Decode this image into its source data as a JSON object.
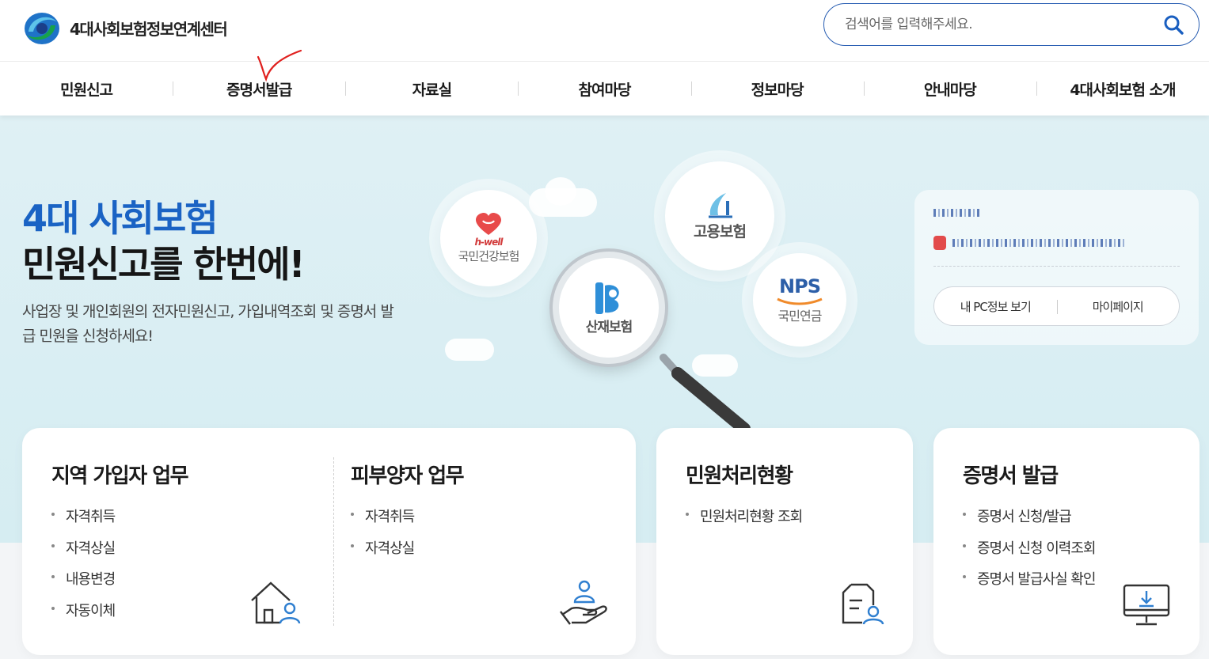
{
  "header": {
    "logo_text": "4대사회보험정보연계센터",
    "search_placeholder": "검색어를 입력해주세요."
  },
  "nav": {
    "items": [
      "민원신고",
      "증명서발급",
      "자료실",
      "참여마당",
      "정보마당",
      "안내마당",
      "4대사회보험 소개"
    ]
  },
  "hero": {
    "title_line1": "4대 사회보험",
    "title_line2": "민원신고를 한번에!",
    "description": "사업장 및 개인회원의 전자민원신고, 가입내역조회 및 증명서 발급 민원을 신청하세요!",
    "circles": {
      "health": {
        "brand": "h-well",
        "label": "국민건강보험"
      },
      "employment": {
        "label": "고용보험"
      },
      "industrial": {
        "label": "산재보험"
      },
      "pension": {
        "brand": "NPS",
        "label": "국민연금"
      }
    }
  },
  "info_box": {
    "button_pc_info": "내 PC정보 보기",
    "button_mypage": "마이페이지"
  },
  "cards": {
    "regional": {
      "title": "지역 가입자 업무",
      "items": [
        "자격취득",
        "자격상실",
        "내용변경",
        "자동이체"
      ]
    },
    "dependent": {
      "title": "피부양자 업무",
      "items": [
        "자격취득",
        "자격상실"
      ]
    },
    "status": {
      "title": "민원처리현황",
      "items": [
        "민원처리현황 조회"
      ]
    },
    "certificate": {
      "title": "증명서 발급",
      "items": [
        "증명서 신청/발급",
        "증명서 신청 이력조회",
        "증명서 발급사실 확인"
      ]
    }
  },
  "colors": {
    "brand_blue": "#1a63c4",
    "hero_bg": "#dcf0f4",
    "icon_blue": "#2f7fd0",
    "annotation_red": "#e0201e"
  }
}
